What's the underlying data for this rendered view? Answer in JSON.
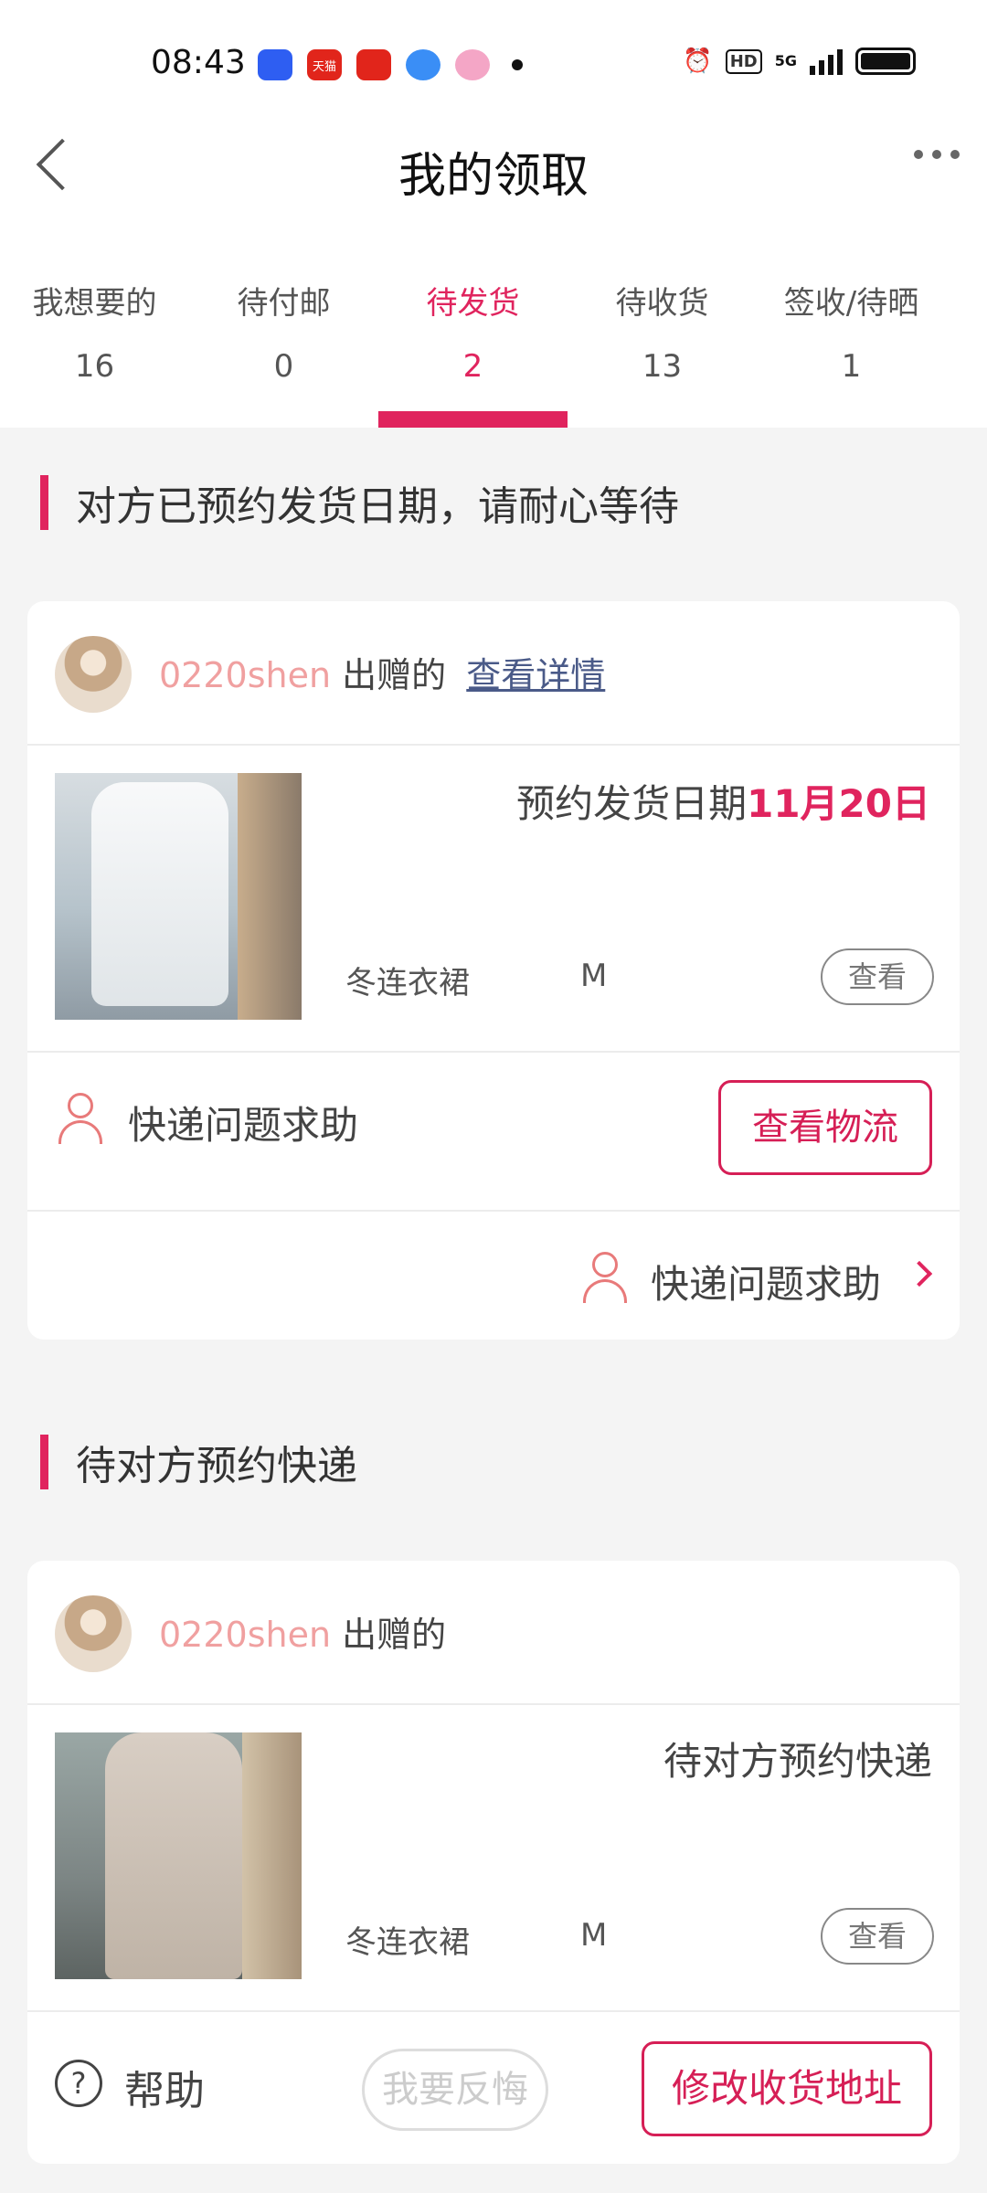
{
  "status_bar": {
    "time": "08:43",
    "apps": [
      {
        "name": "baidu-icon",
        "label": "",
        "color": "#2e5ef2"
      },
      {
        "name": "tmall-icon",
        "label": "天猫",
        "color": "#e1251b"
      },
      {
        "name": "search-app-icon",
        "label": "",
        "color": "#e1251b"
      },
      {
        "name": "blue-app-icon",
        "label": "",
        "color": "#3a8ef6"
      },
      {
        "name": "pink-app-icon",
        "label": "",
        "color": "#f4a6c6"
      }
    ],
    "hd": "HD",
    "network": "5G"
  },
  "nav": {
    "title": "我的领取"
  },
  "tabs": [
    {
      "label": "我想要的",
      "count": "16"
    },
    {
      "label": "待付邮",
      "count": "0"
    },
    {
      "label": "待发货",
      "count": "2"
    },
    {
      "label": "待收货",
      "count": "13"
    },
    {
      "label": "签收/待晒",
      "count": "1"
    }
  ],
  "sections": [
    {
      "heading": "对方已预约发货日期，请耐心等待",
      "card": {
        "user": "0220shen",
        "gift": "出赠的",
        "detail_link": "查看详情",
        "status_prefix": "预约发货日期",
        "status_date": "11月20日",
        "item_name": "冬连衣裙",
        "item_size": "M",
        "view_label": "查看",
        "help_label": "快递问题求助",
        "track_label": "查看物流",
        "help_label_2": "快递问题求助"
      }
    },
    {
      "heading": "待对方预约快递",
      "card": {
        "user": "0220shen",
        "gift": "出赠的",
        "status": "待对方预约快递",
        "item_name": "冬连衣裙",
        "item_size": "M",
        "view_label": "查看"
      }
    }
  ],
  "bottom_bar": {
    "help": "帮助",
    "regret": "我要反悔",
    "change_address": "修改收货地址"
  },
  "colors": {
    "accent": "#e0245e",
    "username": "#f0a0a0",
    "link": "#4a5a88"
  }
}
